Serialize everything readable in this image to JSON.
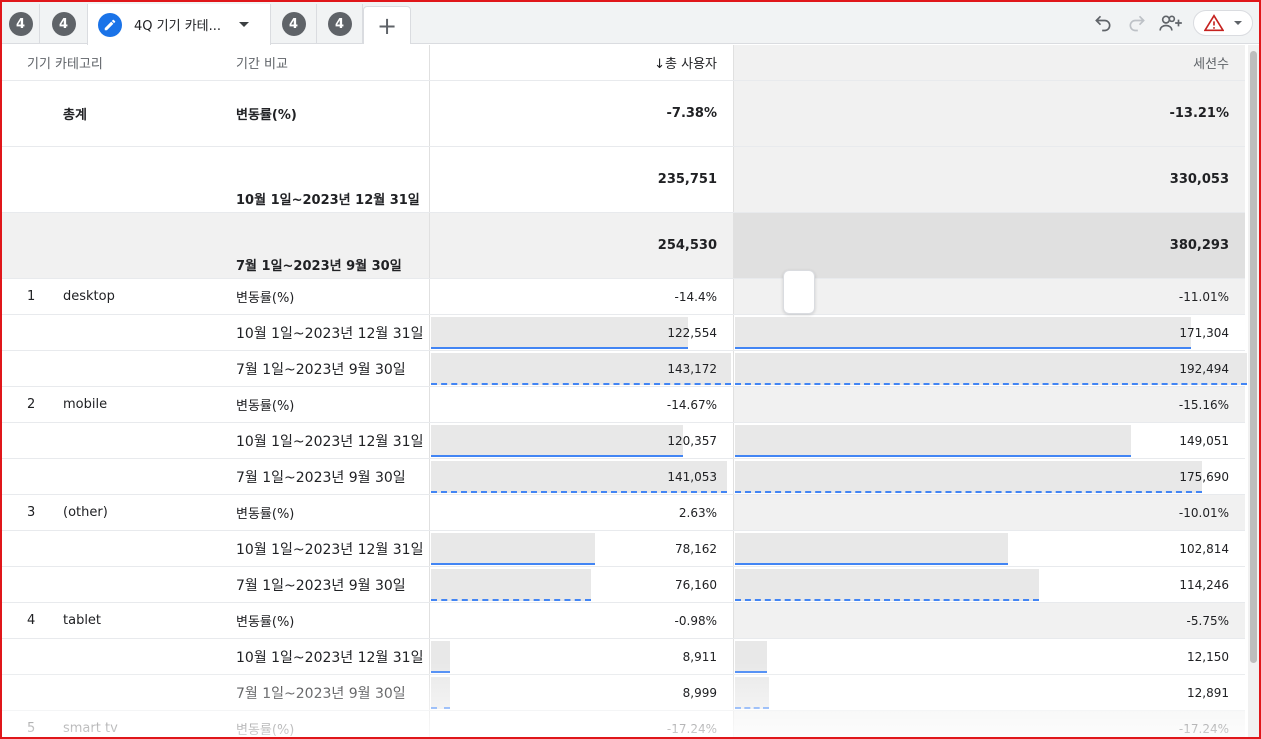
{
  "tabs": [
    {
      "badge": "4"
    },
    {
      "badge": "4"
    },
    {
      "label": "4Q 기기 카테...",
      "active": true
    },
    {
      "badge": "4"
    },
    {
      "badge": "4"
    }
  ],
  "add_tab_label": "+",
  "toolbar": {
    "icons": [
      "undo-icon",
      "redo-icon",
      "share-user-icon",
      "warning-icon"
    ]
  },
  "columns": {
    "dim1": "기기 카테고리",
    "dim2": "기간 비교",
    "metric1": "↓총 사용자",
    "metric2": "세션수"
  },
  "max_users": 143172,
  "max_sessions": 192494,
  "total": {
    "label": "총계",
    "change": {
      "label": "변동률(%)",
      "users": "-7.38%",
      "sessions": "-13.21%"
    },
    "current": {
      "label": "10월 1일~2023년 12월 31일",
      "users": "235,751",
      "sessions": "330,053"
    },
    "previous": {
      "label": "7월 1일~2023년 9월 30일",
      "users": "254,530",
      "sessions": "380,293"
    }
  },
  "rows": [
    {
      "rank": "1",
      "category": "desktop",
      "change": {
        "label": "변동률(%)",
        "users": "-14.4%",
        "sessions": "-11.01%"
      },
      "current": {
        "label": "10월 1일~2023년 12월 31일",
        "users": "122,554",
        "sessions": "171,304",
        "users_val": 122554,
        "sessions_val": 171304
      },
      "previous": {
        "label": "7월 1일~2023년 9월 30일",
        "users": "143,172",
        "sessions": "192,494",
        "users_val": 143172,
        "sessions_val": 192494
      }
    },
    {
      "rank": "2",
      "category": "mobile",
      "change": {
        "label": "변동률(%)",
        "users": "-14.67%",
        "sessions": "-15.16%"
      },
      "current": {
        "label": "10월 1일~2023년 12월 31일",
        "users": "120,357",
        "sessions": "149,051",
        "users_val": 120357,
        "sessions_val": 149051
      },
      "previous": {
        "label": "7월 1일~2023년 9월 30일",
        "users": "141,053",
        "sessions": "175,690",
        "users_val": 141053,
        "sessions_val": 175690
      }
    },
    {
      "rank": "3",
      "category": "(other)",
      "change": {
        "label": "변동률(%)",
        "users": "2.63%",
        "sessions": "-10.01%"
      },
      "current": {
        "label": "10월 1일~2023년 12월 31일",
        "users": "78,162",
        "sessions": "102,814",
        "users_val": 78162,
        "sessions_val": 102814
      },
      "previous": {
        "label": "7월 1일~2023년 9월 30일",
        "users": "76,160",
        "sessions": "114,246",
        "users_val": 76160,
        "sessions_val": 114246
      }
    },
    {
      "rank": "4",
      "category": "tablet",
      "change": {
        "label": "변동률(%)",
        "users": "-0.98%",
        "sessions": "-5.75%"
      },
      "current": {
        "label": "10월 1일~2023년 12월 31일",
        "users": "8,911",
        "sessions": "12,150",
        "users_val": 8911,
        "sessions_val": 12150
      },
      "previous": {
        "label": "7월 1일~2023년 9월 30일",
        "users": "8,999",
        "sessions": "12,891",
        "users_val": 8999,
        "sessions_val": 12891
      }
    },
    {
      "rank": "5",
      "category": "smart tv",
      "change": {
        "label": "변동률(%)",
        "users": "-17.24%",
        "sessions": "-17.24%"
      }
    }
  ]
}
